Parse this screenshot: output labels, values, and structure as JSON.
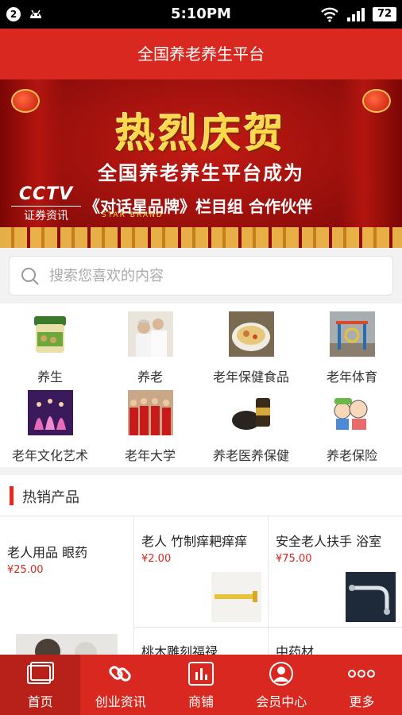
{
  "status_bar": {
    "notification_count": "2",
    "time": "5:10PM",
    "battery": "72"
  },
  "header": {
    "title": "全国养老养生平台"
  },
  "banner": {
    "headline": "热烈庆贺",
    "line1": "全国养老养生平台成为",
    "logo_text": "CCTV",
    "logo_sub": "证券资讯",
    "line2": "《对话星品牌》栏目组 合作伙伴",
    "brand_en": "STAR BRAND"
  },
  "search": {
    "placeholder": "搜索您喜欢的内容"
  },
  "categories": [
    {
      "label": "养生",
      "icon": "health-product-jar"
    },
    {
      "label": "养老",
      "icon": "elderly-couple-photo"
    },
    {
      "label": "老年保健食品",
      "icon": "soup-bowl-photo"
    },
    {
      "label": "老年体育",
      "icon": "fitness-equipment-photo"
    },
    {
      "label": "老年文化艺术",
      "icon": "dance-performance-photo"
    },
    {
      "label": "老年大学",
      "icon": "group-photo"
    },
    {
      "label": "养老医养保健",
      "icon": "herbal-product-photo"
    },
    {
      "label": "养老保险",
      "icon": "cartoon-family-photo"
    }
  ],
  "hot_section": {
    "title": "热销产品"
  },
  "products": [
    {
      "name": "老人用品 眼药",
      "price": "¥25.00"
    },
    {
      "name": "老人 竹制痒耙痒痒",
      "price": "¥2.00"
    },
    {
      "name": "安全老人扶手 浴室",
      "price": "¥75.00"
    },
    {
      "name": "桃木雕刻福禄",
      "price": ""
    },
    {
      "name": "中药材",
      "price": ""
    }
  ],
  "tabs": [
    {
      "label": "首页",
      "icon": "home-icon"
    },
    {
      "label": "创业资讯",
      "icon": "link-icon"
    },
    {
      "label": "商铺",
      "icon": "shop-chart-icon"
    },
    {
      "label": "会员中心",
      "icon": "user-icon"
    },
    {
      "label": "更多",
      "icon": "more-icon"
    }
  ],
  "colors": {
    "brand_red": "#d8281f",
    "price_red": "#d8281f",
    "status_bar": "#000000"
  }
}
